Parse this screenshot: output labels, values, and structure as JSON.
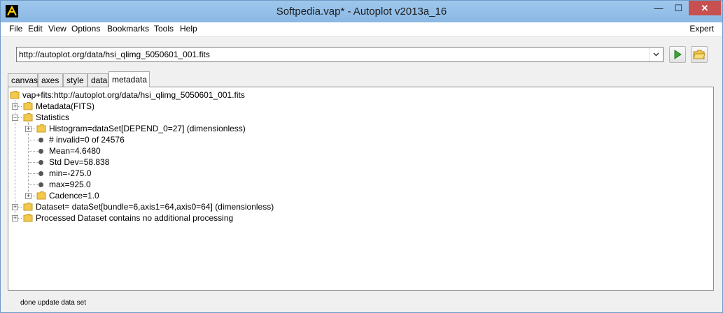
{
  "window": {
    "title": "Softpedia.vap* - Autoplot v2013a_16",
    "app_icon": "autoplot-logo-icon",
    "minimize_label": "—",
    "maximize_label": "☐",
    "close_label": "✕"
  },
  "menubar": {
    "items": [
      "File",
      "Edit",
      "View",
      "Options",
      "Bookmarks",
      "Tools",
      "Help"
    ],
    "expert": "Expert"
  },
  "url_bar": {
    "value": "http://autoplot.org/data/hsi_qlimg_5050601_001.fits",
    "dropdown_icon": "chevron-down-icon",
    "go_icon": "play-icon",
    "browse_icon": "open-folder-icon"
  },
  "tabs": [
    "canvas",
    "axes",
    "style",
    "data",
    "metadata"
  ],
  "active_tab": "metadata",
  "tree": {
    "root": "vap+fits:http://autoplot.org/data/hsi_qlimg_5050601_001.fits",
    "nodes": [
      "Metadata(FITS)",
      "Statistics",
      "Histogram=dataSet[DEPEND_0=27] (dimensionless)",
      "# invalid=0 of 24576",
      "Mean=4.6480",
      "Std Dev=58.838",
      "min=-275.0",
      "max=925.0",
      "Cadence=1.0",
      "Dataset= dataSet[bundle=6,axis1=64,axis0=64] (dimensionless)",
      "Processed Dataset contains no additional processing"
    ]
  },
  "status": {
    "text": "done update data set"
  },
  "colors": {
    "titlebar": "#8ab8e4",
    "close_button": "#c75050",
    "folder": "#f2c94c",
    "go_button": "#3aa43a"
  }
}
